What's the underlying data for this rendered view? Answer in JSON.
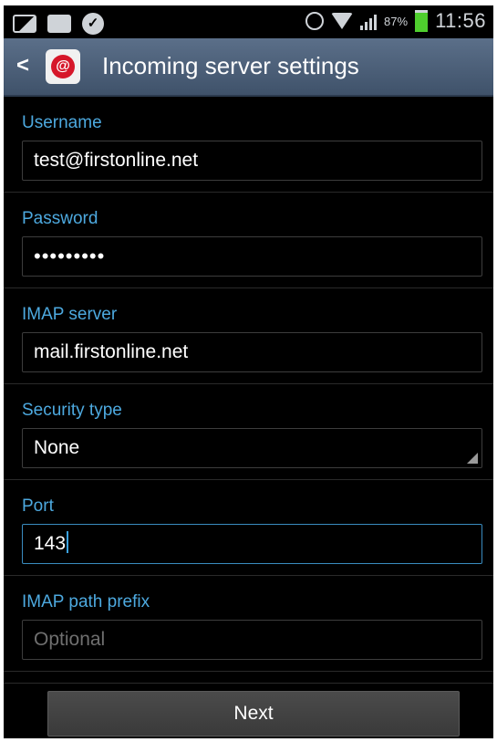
{
  "statusbar": {
    "battery_percent": "87%",
    "time": "11:56",
    "battery_color": "#4fce2e"
  },
  "titlebar": {
    "title": "Incoming server settings",
    "back_icon": "chevron-left-icon",
    "app_icon": "email-app-icon"
  },
  "form": {
    "username": {
      "label": "Username",
      "value": "test@firstonline.net"
    },
    "password": {
      "label": "Password",
      "value": "•••••••••"
    },
    "imap_server": {
      "label": "IMAP server",
      "value": "mail.firstonline.net"
    },
    "security_type": {
      "label": "Security type",
      "value": "None"
    },
    "port": {
      "label": "Port",
      "value": "143"
    },
    "imap_path_prefix": {
      "label": "IMAP path prefix",
      "placeholder": "Optional"
    }
  },
  "footer": {
    "next_label": "Next"
  },
  "colors": {
    "accent": "#4da9df",
    "titlebar": "#4a5d77",
    "focus": "#3a8cc0"
  }
}
